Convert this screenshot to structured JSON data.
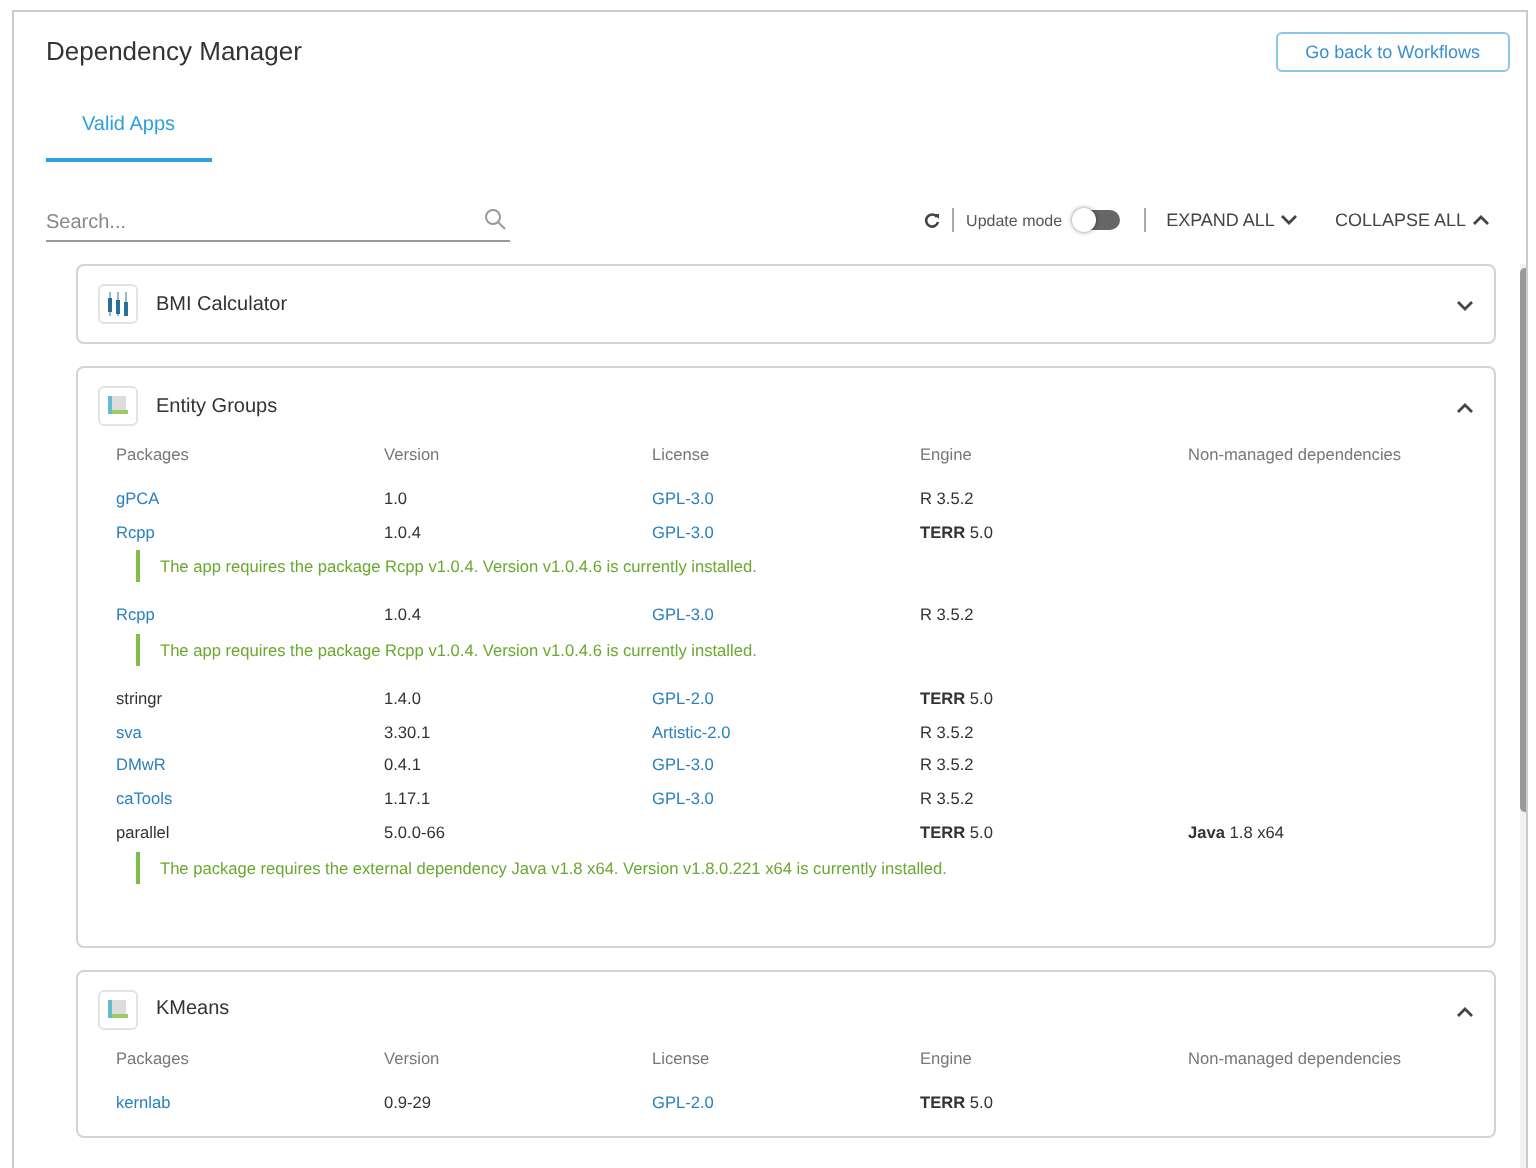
{
  "header": {
    "title": "Dependency Manager",
    "back_button": "Go back to Workflows"
  },
  "tabs": [
    {
      "label": "Valid Apps",
      "selected": true
    }
  ],
  "toolbar": {
    "search_placeholder": "Search...",
    "update_mode_label": "Update mode",
    "update_mode_on": false,
    "expand_all": "EXPAND ALL",
    "collapse_all": "COLLAPSE ALL"
  },
  "apps": [
    {
      "name": "BMI Calculator",
      "expanded": false
    },
    {
      "name": "Entity Groups",
      "expanded": true,
      "columns": [
        "Packages",
        "Version",
        "License",
        "Engine",
        "Non-managed dependencies"
      ],
      "rows": [
        {
          "package": "gPCA",
          "linked": true,
          "version": "1.0",
          "license": "GPL-3.0",
          "engine": "R 3.5.2"
        },
        {
          "package": "Rcpp",
          "linked": true,
          "version": "1.0.4",
          "license": "GPL-3.0",
          "engine": "**TERR** 5.0",
          "note": "The app requires the package Rcpp v1.0.4. Version v1.0.4.6 is currently installed."
        },
        {
          "package": "Rcpp",
          "linked": true,
          "version": "1.0.4",
          "license": "GPL-3.0",
          "engine": "R 3.5.2",
          "note": "The app requires the package Rcpp v1.0.4. Version v1.0.4.6 is currently installed."
        },
        {
          "package": "stringr",
          "linked": false,
          "version": "1.4.0",
          "license": "GPL-2.0",
          "engine": "**TERR** 5.0"
        },
        {
          "package": "sva",
          "linked": true,
          "version": "3.30.1",
          "license": "Artistic-2.0",
          "engine": "R 3.5.2"
        },
        {
          "package": "DMwR",
          "linked": true,
          "version": "0.4.1",
          "license": "GPL-3.0",
          "engine": "R 3.5.2"
        },
        {
          "package": "caTools",
          "linked": true,
          "version": "1.17.1",
          "license": "GPL-3.0",
          "engine": "R 3.5.2"
        },
        {
          "package": "parallel",
          "linked": false,
          "version": "5.0.0-66",
          "engine": "**TERR** 5.0",
          "dependency": "**Java** 1.8 x64",
          "note": "The package requires the external dependency Java v1.8 x64. Version v1.8.0.221 x64 is currently installed."
        }
      ]
    },
    {
      "name": "KMeans",
      "expanded": true,
      "columns": [
        "Packages",
        "Version",
        "License",
        "Engine",
        "Non-managed dependencies"
      ],
      "rows": [
        {
          "package": "kernlab",
          "linked": true,
          "version": "0.9-29",
          "license": "GPL-2.0",
          "engine": "**TERR** 5.0"
        }
      ]
    }
  ]
}
